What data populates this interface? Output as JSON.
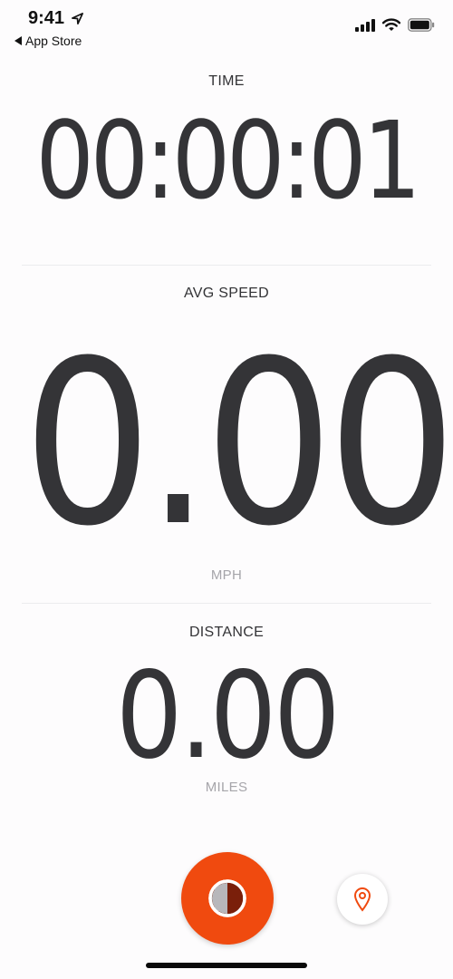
{
  "status_bar": {
    "time": "9:41",
    "back_label": "App Store",
    "icons": [
      "location-arrow-icon",
      "cellular-signal-icon",
      "wifi-icon",
      "battery-icon"
    ]
  },
  "time": {
    "label": "TIME",
    "value": "00:00:01"
  },
  "avg_speed": {
    "label": "AVG SPEED",
    "value": "0.00",
    "unit": "MPH"
  },
  "distance": {
    "label": "DISTANCE",
    "value": "0.00",
    "unit": "MILES"
  },
  "controls": {
    "record_icon": "record-icon",
    "location_icon": "map-pin-icon"
  },
  "colors": {
    "accent": "#f04a0f",
    "text_primary": "#343437",
    "text_secondary": "#a6a5aa",
    "background": "#fdfcfd"
  }
}
